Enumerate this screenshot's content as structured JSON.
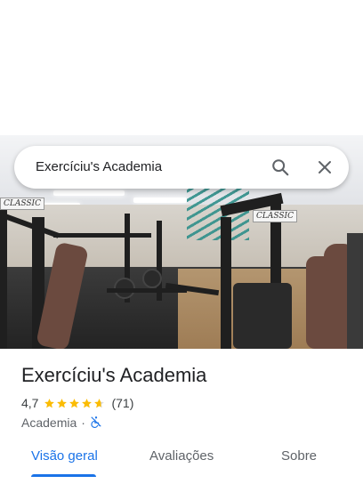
{
  "search": {
    "query": "Exercíciu's Academia",
    "search_icon": "search-icon",
    "close_icon": "close-icon"
  },
  "hero": {
    "photo_icon": "gym-photo",
    "sign_text": "CLASSIC"
  },
  "place": {
    "name": "Exercíciu's Academia",
    "rating": "4,7",
    "rating_value": 4.7,
    "rating_max": 5,
    "review_count": "(71)",
    "category": "Academia",
    "separator": "·",
    "accessibility_icon": "not-accessible-icon"
  },
  "tabs": [
    {
      "label": "Visão geral",
      "active": true
    },
    {
      "label": "Avaliações",
      "active": false
    },
    {
      "label": "Sobre",
      "active": false
    }
  ],
  "colors": {
    "accent": "#1a73e8",
    "star": "#fbbc04",
    "text_primary": "#202124",
    "text_secondary": "#5f6368"
  }
}
